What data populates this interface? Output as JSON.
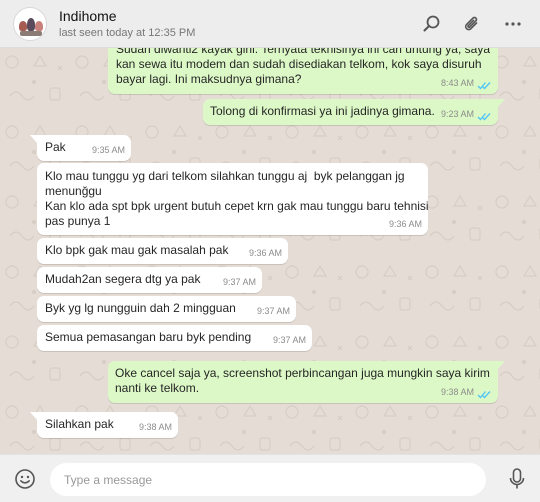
{
  "contact": {
    "name": "Indihome",
    "status": "last seen today at 12:35 PM"
  },
  "header_icons": [
    "search-icon",
    "attach-icon",
    "more-icon"
  ],
  "colors": {
    "incoming": "#ffffff",
    "outgoing": "#dcf8c6",
    "read_ticks": "#4fc3f7",
    "wallpaper": "#e5ddd5"
  },
  "messages": [
    {
      "dir": "out",
      "text": "Sudah diwanti2 kayak gini. Ternyata teknisinya ini cari untung ya, saya\nkan sewa itu modem dan sudah disediakan telkom, kok saya disuruh\nbayar lagi. Ini maksudnya gimana?",
      "time": "8:43 AM",
      "read": true
    },
    {
      "dir": "out",
      "text": "Tolong di konfirmasi ya ini jadinya gimana.",
      "time": "9:23 AM",
      "read": true
    },
    {
      "dir": "in",
      "text": "Pak",
      "time": "9:35 AM"
    },
    {
      "dir": "in",
      "text": "Klo mau tunggu yg dari telkom silahkan tunggu aj  byk pelanggan jg\nmenunğgu\nKan klo ada spt bpk urgent butuh cepet krn gak mau tunggu baru tehnisi\npas punya 1",
      "time": "9:36 AM"
    },
    {
      "dir": "in",
      "text": "Klo bpk gak mau gak masalah pak",
      "time": "9:36 AM"
    },
    {
      "dir": "in",
      "text": "Mudah2an segera dtg ya pak",
      "time": "9:37 AM"
    },
    {
      "dir": "in",
      "text": "Byk yg lg nungguin dah 2 mingguan",
      "time": "9:37 AM"
    },
    {
      "dir": "in",
      "text": "Semua pemasangan baru byk pending",
      "time": "9:37 AM"
    },
    {
      "dir": "out",
      "text": "Oke cancel saja ya, screenshot perbincangan juga mungkin saya kirim\nnanti ke telkom.",
      "time": "9:38 AM",
      "read": true
    },
    {
      "dir": "in",
      "text": "Silahkan pak",
      "time": "9:38 AM"
    }
  ],
  "composer": {
    "placeholder": "Type a message"
  }
}
